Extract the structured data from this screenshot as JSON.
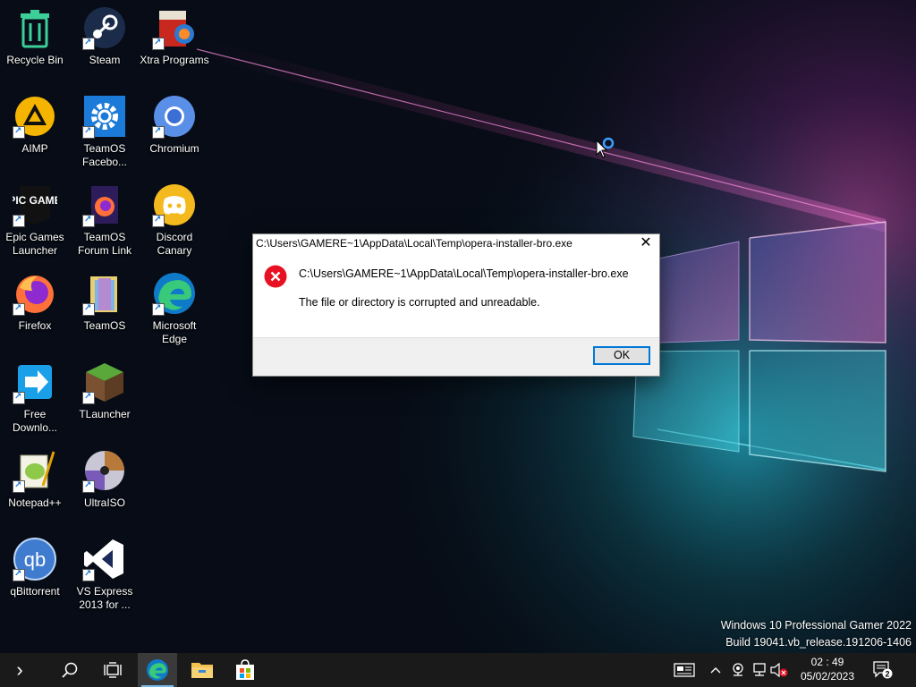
{
  "desktop": {
    "icons": [
      {
        "id": "recycle-bin",
        "label": "Recycle Bin"
      },
      {
        "id": "steam",
        "label": "Steam"
      },
      {
        "id": "xtra-programs",
        "label": "Xtra Programs"
      },
      {
        "id": "aimp",
        "label": "AIMP"
      },
      {
        "id": "teamos-facebook",
        "label": "TeamOS Facebo..."
      },
      {
        "id": "chromium",
        "label": "Chromium"
      },
      {
        "id": "epic-games",
        "label": "Epic Games Launcher",
        "logo_text": "EPIC GAMES"
      },
      {
        "id": "teamos-forum",
        "label": "TeamOS Forum Link"
      },
      {
        "id": "discord-canary",
        "label": "Discord Canary"
      },
      {
        "id": "firefox",
        "label": "Firefox"
      },
      {
        "id": "teamos",
        "label": "TeamOS"
      },
      {
        "id": "microsoft-edge",
        "label": "Microsoft Edge"
      },
      {
        "id": "free-download",
        "label": "Free Downlo..."
      },
      {
        "id": "tlauncher",
        "label": "TLauncher"
      },
      {
        "id": "notepadpp",
        "label": "Notepad++"
      },
      {
        "id": "ultraiso",
        "label": "UltraISO"
      },
      {
        "id": "qbittorrent",
        "label": "qBittorrent",
        "logo_text": "qb"
      },
      {
        "id": "vs-express",
        "label": "VS Express 2013 for ..."
      }
    ]
  },
  "dialog": {
    "title": "C:\\Users\\GAMERE~1\\AppData\\Local\\Temp\\opera-installer-bro.exe",
    "path": "C:\\Users\\GAMERE~1\\AppData\\Local\\Temp\\opera-installer-bro.exe",
    "message": "The file or directory is corrupted and unreadable.",
    "ok_label": "OK",
    "close_glyph": "✕",
    "error_glyph": "✕"
  },
  "watermark": {
    "edition": "Windows 10 Professional Gamer 2022",
    "build": "Build 19041.vb_release.191206-1406"
  },
  "taskbar": {
    "start_glyph": "›",
    "clock_time": "02 : 49",
    "clock_date": "05/02/2023",
    "notification_count": "2"
  },
  "colors": {
    "accent": "#0078d7",
    "error": "#e81123",
    "taskbar": "#1a1a1a"
  }
}
